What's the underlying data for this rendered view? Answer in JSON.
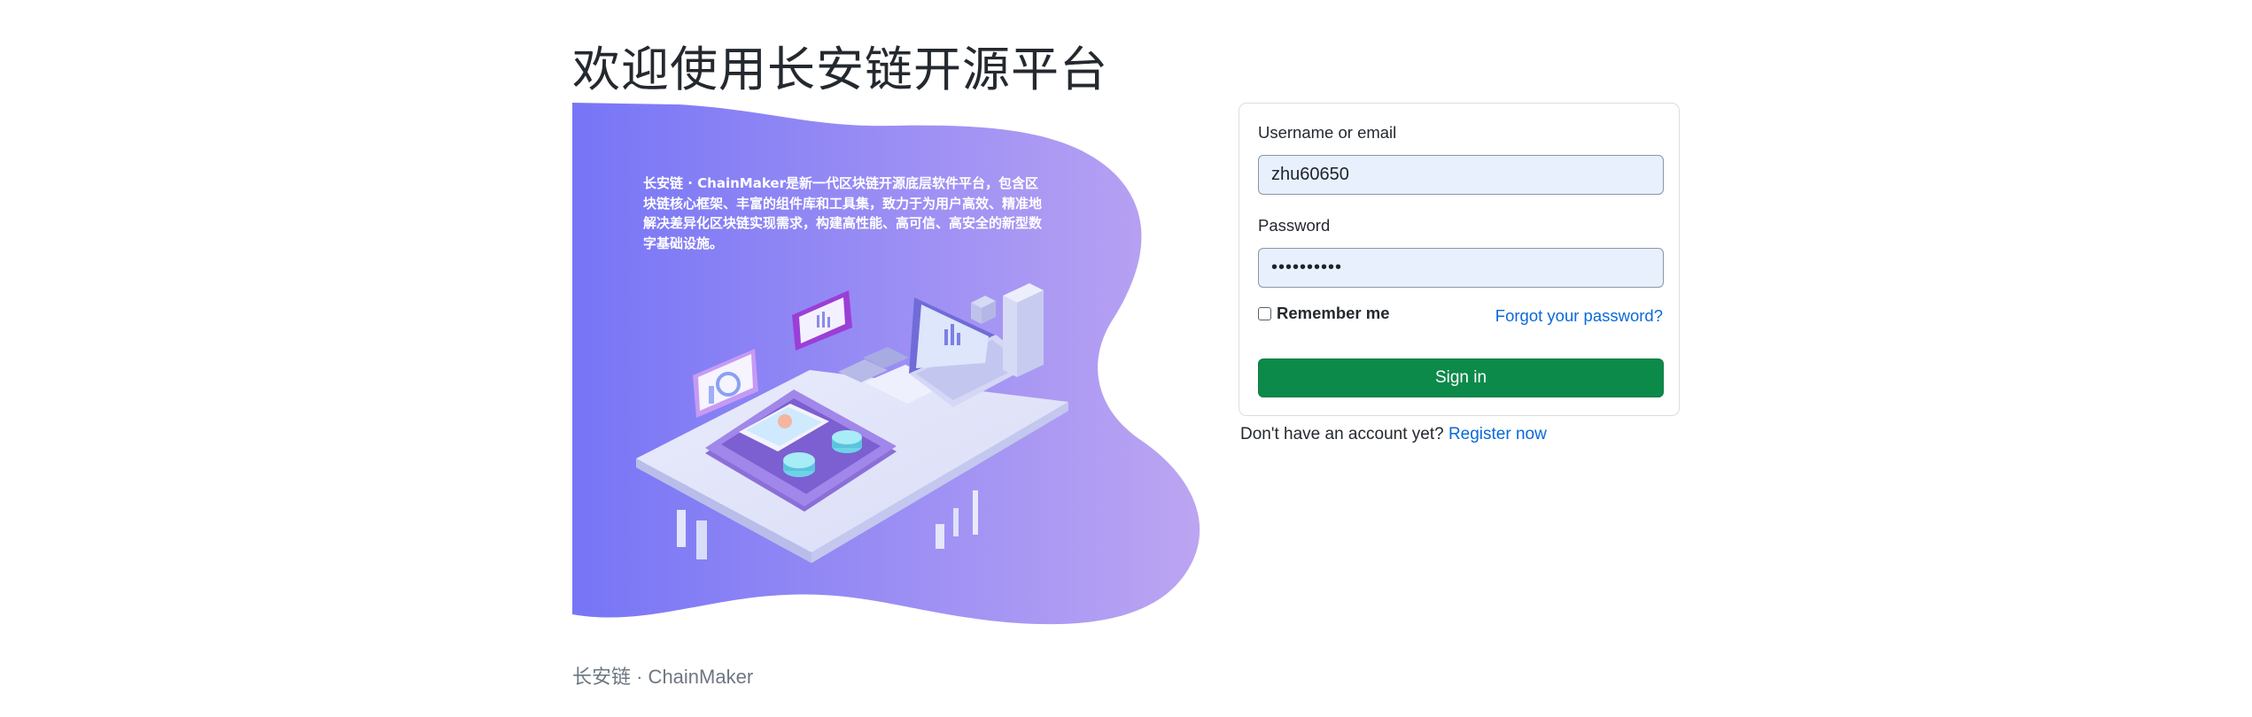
{
  "header": {
    "title": "欢迎使用长安链开源平台"
  },
  "hero": {
    "description": "长安链 · ChainMaker是新一代区块链开源底层软件平台，包含区块链核心框架、丰富的组件库和工具集，致力于为用户高效、精准地解决差异化区块链实现需求，构建高性能、高可信、高安全的新型数字基础设施。",
    "gradient_start": "#7b79f7",
    "gradient_end": "#b7a2f3"
  },
  "login": {
    "username_label": "Username or email",
    "username_value": "zhu60650",
    "password_label": "Password",
    "password_value": "••••••••••",
    "remember_label": "Remember me",
    "remember_checked": false,
    "forgot_link": "Forgot your password?",
    "signin_label": "Sign in",
    "signin_color": "#0c8a4a",
    "input_bg": "#e8f0fe"
  },
  "register": {
    "prompt": "Don't have an account yet?",
    "link": "Register now"
  },
  "footer": {
    "text": "长安链 · ChainMaker"
  }
}
